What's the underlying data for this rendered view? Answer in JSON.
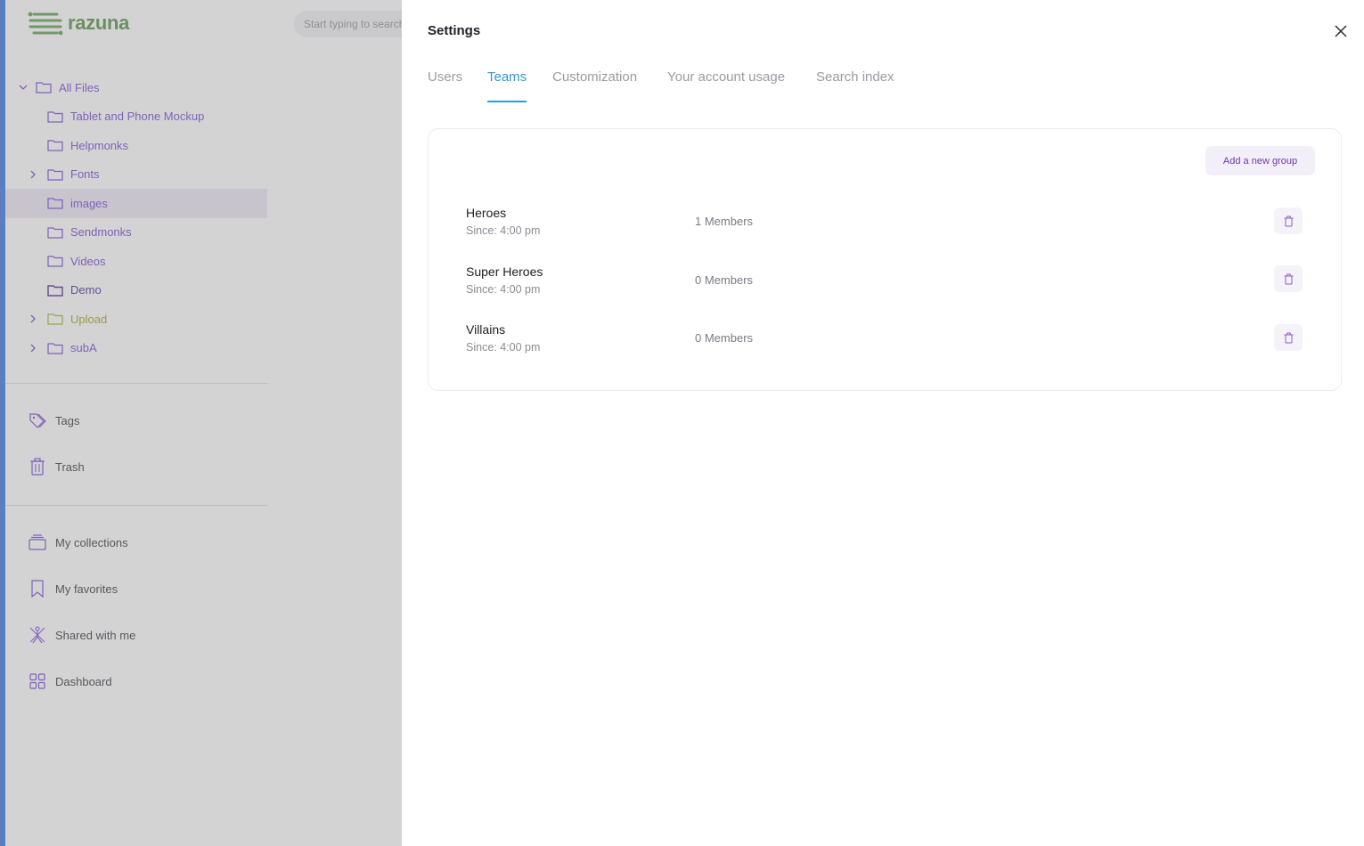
{
  "app": {
    "logo_text": "razuna",
    "search_placeholder": "Start typing to search"
  },
  "sidebar": {
    "folders": [
      {
        "label": "All Files",
        "expanded": true,
        "level": 0
      },
      {
        "label": "Tablet and Phone Mockup",
        "level": 1
      },
      {
        "label": "Helpmonks",
        "level": 1
      },
      {
        "label": "Fonts",
        "level": 1,
        "has_children": true
      },
      {
        "label": "images",
        "level": 1,
        "selected": true
      },
      {
        "label": "Sendmonks",
        "level": 1
      },
      {
        "label": "Videos",
        "level": 1
      },
      {
        "label": "Demo",
        "level": 1
      },
      {
        "label": "Upload",
        "level": 1,
        "has_children": true
      },
      {
        "label": "subA",
        "level": 1,
        "has_children": true
      }
    ],
    "section_a": [
      {
        "label": "Tags",
        "icon": "tag-icon"
      },
      {
        "label": "Trash",
        "icon": "trash-icon"
      }
    ],
    "section_b": [
      {
        "label": "My collections",
        "icon": "collections-icon"
      },
      {
        "label": "My favorites",
        "icon": "bookmark-icon"
      },
      {
        "label": "Shared with me",
        "icon": "shared-icon"
      },
      {
        "label": "Dashboard",
        "icon": "dashboard-icon"
      }
    ]
  },
  "settings": {
    "title": "Settings",
    "tabs": [
      {
        "label": "Users",
        "active": false
      },
      {
        "label": "Teams",
        "active": true
      },
      {
        "label": "Customization",
        "active": false
      },
      {
        "label": "Your account usage",
        "active": false
      },
      {
        "label": "Search index",
        "active": false
      }
    ],
    "add_group_label": "Add a new group",
    "teams": [
      {
        "name": "Heroes",
        "since": "Since: 4:00 pm",
        "members": "1 Members"
      },
      {
        "name": "Super Heroes",
        "since": "Since: 4:00 pm",
        "members": "0 Members"
      },
      {
        "name": "Villains",
        "since": "Since: 4:00 pm",
        "members": "0 Members"
      }
    ]
  },
  "colors": {
    "accent_tab": "#2c9bd6",
    "folder_purple": "#6e3bd6",
    "logo_green": "#4a8a3c",
    "left_rail": "#2f6fe0"
  }
}
